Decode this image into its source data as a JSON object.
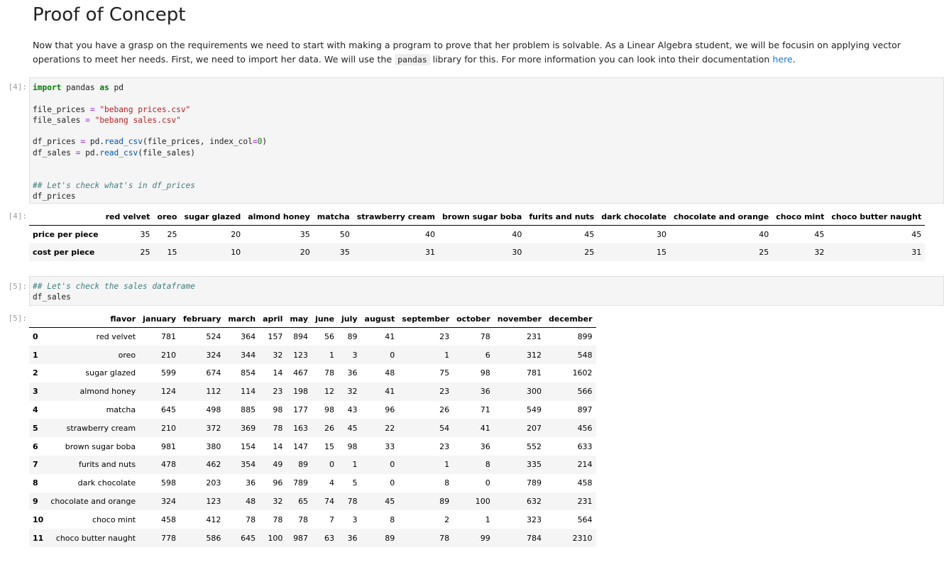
{
  "heading": "Proof of Concept",
  "intro": {
    "before_code": "Now that you have a grasp on the requirements we need to start with making a program to prove that her problem is solvable. As a Linear Algebra student, we will be focusin on applying vector operations to meet her needs. First, we need to import her data. We will use the ",
    "code": "pandas",
    "after_code": " library for this. For more information you can look into their documentation ",
    "link": "here",
    "end": "."
  },
  "cell4": {
    "in_prompt": "[4]:",
    "out_prompt": "[4]:",
    "code": {
      "l1_kw1": "import",
      "l1_mid": " pandas ",
      "l1_kw2": "as",
      "l1_end": " pd",
      "l3_var": "file_prices ",
      "l3_op": "=",
      "l3_str": " \"bebang prices.csv\"",
      "l4_var": "file_sales ",
      "l4_op": "=",
      "l4_str": " \"bebang sales.csv\"",
      "l6_a": "df_prices ",
      "l6_op": "=",
      "l6_b": " pd.",
      "l6_fn": "read_csv",
      "l6_c": "(file_prices, index_col",
      "l6_op2": "=",
      "l6_num": "0",
      "l6_d": ")",
      "l7_a": "df_sales ",
      "l7_op": "=",
      "l7_b": " pd.",
      "l7_fn": "read_csv",
      "l7_c": "(file_sales)",
      "l10_cm": "## Let's check what's in df_prices",
      "l11": "df_prices"
    }
  },
  "prices_table": {
    "columns": [
      "",
      "red velvet",
      "oreo",
      "sugar glazed",
      "almond honey",
      "matcha",
      "strawberry cream",
      "brown sugar boba",
      "furits and nuts",
      "dark chocolate",
      "chocolate and orange",
      "choco mint",
      "choco butter naught"
    ],
    "rows": [
      [
        "price per piece",
        "35",
        "25",
        "20",
        "35",
        "50",
        "40",
        "40",
        "45",
        "30",
        "40",
        "45",
        "45"
      ],
      [
        "cost per piece",
        "25",
        "15",
        "10",
        "20",
        "35",
        "31",
        "30",
        "25",
        "15",
        "25",
        "32",
        "31"
      ]
    ]
  },
  "cell5": {
    "in_prompt": "[5]:",
    "out_prompt": "[5]:",
    "code": {
      "l1_cm": "## Let's check the sales dataframe",
      "l2": "df_sales"
    }
  },
  "sales_table": {
    "columns": [
      "",
      "flavor",
      "january",
      "february",
      "march",
      "april",
      "may",
      "june",
      "july",
      "august",
      "september",
      "october",
      "november",
      "december"
    ],
    "rows": [
      [
        "0",
        "red velvet",
        "781",
        "524",
        "364",
        "157",
        "894",
        "56",
        "89",
        "41",
        "23",
        "78",
        "231",
        "899"
      ],
      [
        "1",
        "oreo",
        "210",
        "324",
        "344",
        "32",
        "123",
        "1",
        "3",
        "0",
        "1",
        "6",
        "312",
        "548"
      ],
      [
        "2",
        "sugar glazed",
        "599",
        "674",
        "854",
        "14",
        "467",
        "78",
        "36",
        "48",
        "75",
        "98",
        "781",
        "1602"
      ],
      [
        "3",
        "almond honey",
        "124",
        "112",
        "114",
        "23",
        "198",
        "12",
        "32",
        "41",
        "23",
        "36",
        "300",
        "566"
      ],
      [
        "4",
        "matcha",
        "645",
        "498",
        "885",
        "98",
        "177",
        "98",
        "43",
        "96",
        "26",
        "71",
        "549",
        "897"
      ],
      [
        "5",
        "strawberry cream",
        "210",
        "372",
        "369",
        "78",
        "163",
        "26",
        "45",
        "22",
        "54",
        "41",
        "207",
        "456"
      ],
      [
        "6",
        "brown sugar boba",
        "981",
        "380",
        "154",
        "14",
        "147",
        "15",
        "98",
        "33",
        "23",
        "36",
        "552",
        "633"
      ],
      [
        "7",
        "furits and nuts",
        "478",
        "462",
        "354",
        "49",
        "89",
        "0",
        "1",
        "0",
        "1",
        "8",
        "335",
        "214"
      ],
      [
        "8",
        "dark chocolate",
        "598",
        "203",
        "36",
        "96",
        "789",
        "4",
        "5",
        "0",
        "8",
        "0",
        "789",
        "458"
      ],
      [
        "9",
        "chocolate and orange",
        "324",
        "123",
        "48",
        "32",
        "65",
        "74",
        "78",
        "45",
        "89",
        "100",
        "632",
        "231"
      ],
      [
        "10",
        "choco mint",
        "458",
        "412",
        "78",
        "78",
        "78",
        "7",
        "3",
        "8",
        "2",
        "1",
        "323",
        "564"
      ],
      [
        "11",
        "choco butter naught",
        "778",
        "586",
        "645",
        "100",
        "987",
        "63",
        "36",
        "89",
        "78",
        "99",
        "784",
        "2310"
      ]
    ]
  }
}
